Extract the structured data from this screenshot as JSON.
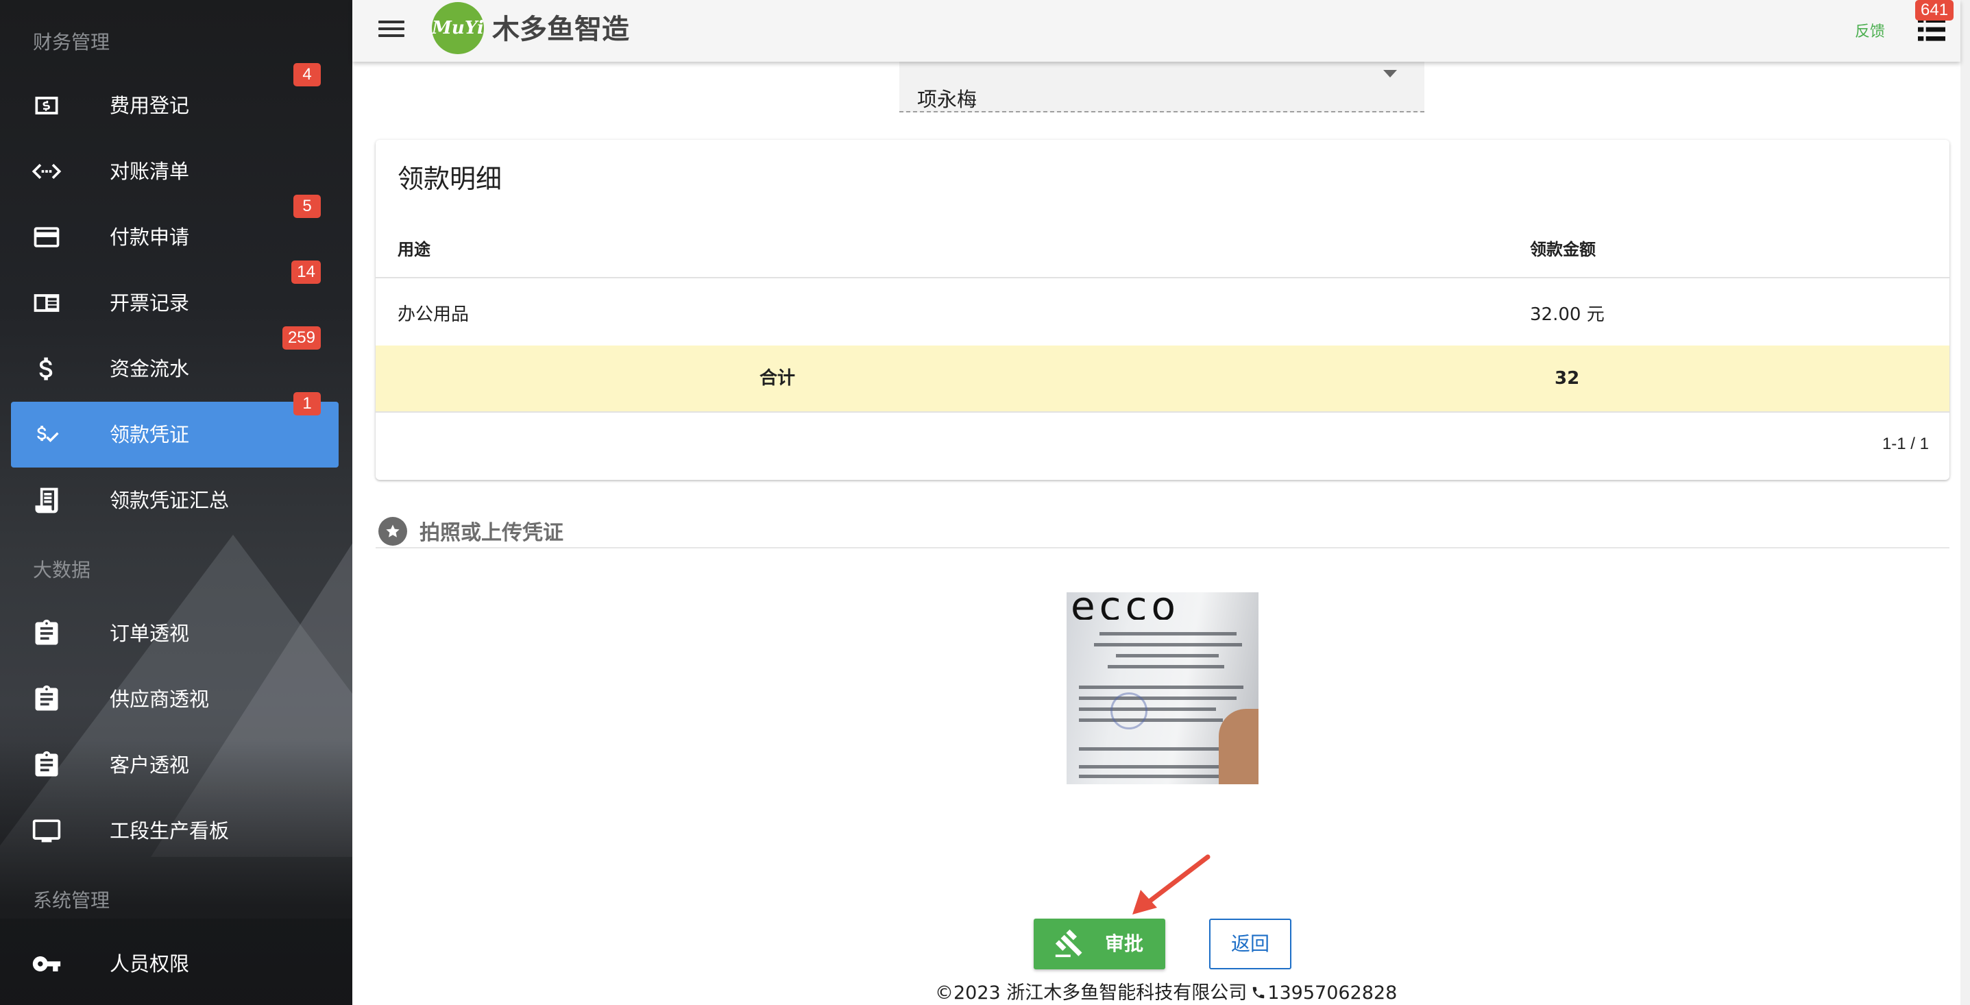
{
  "sidebar": {
    "sections": [
      {
        "title": "财务管理"
      },
      {
        "title": "大数据"
      },
      {
        "title": "系统管理"
      }
    ],
    "items": [
      {
        "label": "费用登记",
        "icon": "dollar-box-icon",
        "badge": "4"
      },
      {
        "label": "对账清单",
        "icon": "code-arrows-icon",
        "badge": ""
      },
      {
        "label": "付款申请",
        "icon": "credit-card-icon",
        "badge": "5"
      },
      {
        "label": "开票记录",
        "icon": "receipt-book-icon",
        "badge": "14"
      },
      {
        "label": "资金流水",
        "icon": "dollar-icon",
        "badge": "259"
      },
      {
        "label": "领款凭证",
        "icon": "dollar-check-icon",
        "badge": "1",
        "active": true
      },
      {
        "label": "领款凭证汇总",
        "icon": "receipt-list-icon",
        "badge": ""
      },
      {
        "label": "订单透视",
        "icon": "clipboard-icon",
        "badge": ""
      },
      {
        "label": "供应商透视",
        "icon": "clipboard-icon",
        "badge": ""
      },
      {
        "label": "客户透视",
        "icon": "clipboard-icon",
        "badge": ""
      },
      {
        "label": "工段生产看板",
        "icon": "monitor-icon",
        "badge": ""
      },
      {
        "label": "人员权限",
        "icon": "key-icon",
        "badge": ""
      }
    ]
  },
  "header": {
    "logo_text": "MuYi",
    "app_title": "木多鱼智造",
    "feedback_label": "反馈",
    "notification_count": "641",
    "icons": {
      "menu": "hamburger-menu-icon",
      "list": "list-icon"
    }
  },
  "approver": {
    "value": "项永梅"
  },
  "detail": {
    "title": "领款明细",
    "columns": [
      "用途",
      "领款金额"
    ],
    "rows": [
      {
        "purpose": "办公用品",
        "amount": "32.00 元"
      }
    ],
    "total_label": "合计",
    "total_value": "32",
    "pagination": "1-1 / 1"
  },
  "upload": {
    "label": "拍照或上传凭证",
    "icon": "star-circle-icon"
  },
  "actions": {
    "approve_label": "审批",
    "approve_icon": "gavel-icon",
    "back_label": "返回"
  },
  "footer": {
    "copyright": "©2023 浙江木多鱼智能科技有限公司",
    "phone": "13957062828"
  },
  "colors": {
    "active_nav": "#4a90e2",
    "badge": "#e74c3c",
    "approve_button": "#4caf50",
    "back_button": "#1e6fc7",
    "total_row": "#fdf6c6",
    "logo": "#6fb23a"
  }
}
